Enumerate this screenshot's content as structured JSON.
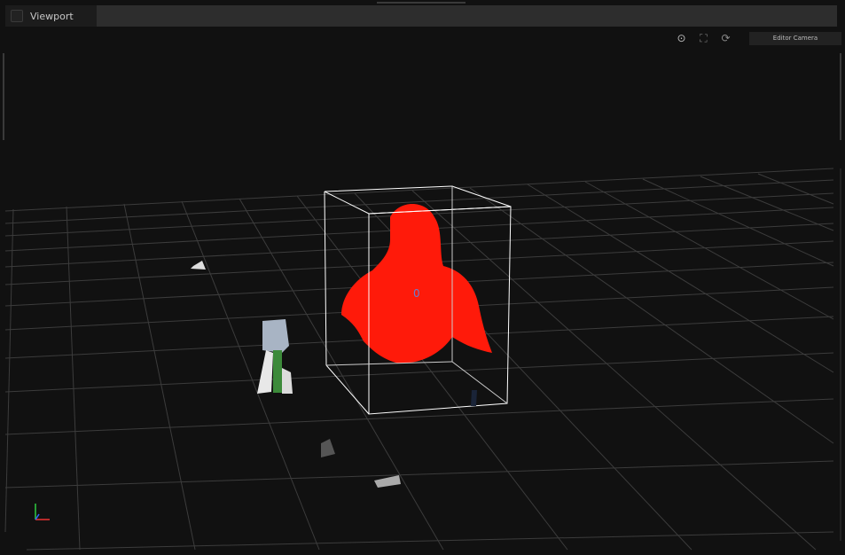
{
  "tab": {
    "title": "Viewport"
  },
  "toolbar": {
    "icons": [
      "focus-icon",
      "fit-view-icon",
      "orbit-reset-icon"
    ],
    "camera_label": "Editor Camera"
  },
  "scene": {
    "selected_color": "#ff1a0a",
    "bbox_color": "#ffffff"
  }
}
